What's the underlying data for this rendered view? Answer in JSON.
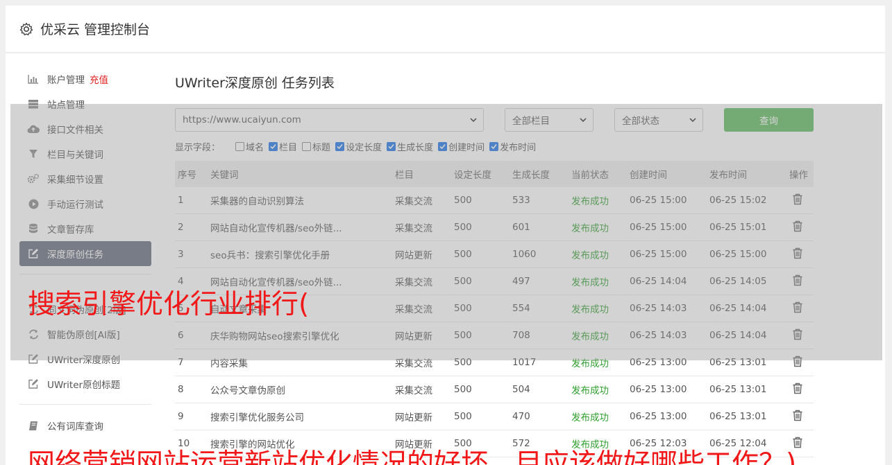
{
  "header": {
    "title": "优采云 管理控制台",
    "icon": "gear-icon"
  },
  "sidebar": {
    "items": [
      {
        "label": "账户管理",
        "badge": "充值",
        "icon": "bar-chart-icon"
      },
      {
        "label": "站点管理",
        "icon": "server-icon"
      },
      {
        "label": "接口文件相关",
        "icon": "cloud-upload-icon"
      },
      {
        "label": "栏目与关键词",
        "icon": "filter-icon"
      },
      {
        "label": "采集细节设置",
        "icon": "gears-icon"
      },
      {
        "label": "手动运行测试",
        "icon": "play-icon"
      },
      {
        "label": "文章暂存库",
        "icon": "database-icon"
      },
      {
        "label": "深度原创任务",
        "icon": "edit-icon",
        "active": true
      },
      {
        "label": "同义词伪原创[2版]",
        "icon": "refresh-icon"
      },
      {
        "label": "智能伪原创[AI版]",
        "icon": "refresh-icon"
      },
      {
        "label": "UWriter深度原创",
        "icon": "edit-icon"
      },
      {
        "label": "UWriter原创标题",
        "icon": "edit-icon"
      },
      {
        "label": "公有词库查询",
        "icon": "book-icon"
      }
    ]
  },
  "main": {
    "title": "UWriter深度原创 任务列表",
    "filters": {
      "site": "https://www.ucaiyun.com",
      "column": "全部栏目",
      "status": "全部状态",
      "query_label": "查询"
    },
    "fields": {
      "label": "显示字段：",
      "options": [
        {
          "label": "域名",
          "checked": false
        },
        {
          "label": "栏目",
          "checked": true
        },
        {
          "label": "标题",
          "checked": false
        },
        {
          "label": "设定长度",
          "checked": true
        },
        {
          "label": "生成长度",
          "checked": true
        },
        {
          "label": "创建时间",
          "checked": true
        },
        {
          "label": "发布时间",
          "checked": true
        }
      ]
    },
    "table": {
      "headers": [
        "序号",
        "关键词",
        "栏目",
        "设定长度",
        "生成长度",
        "当前状态",
        "创建时间",
        "发布时间",
        "操作"
      ],
      "rows": [
        [
          "1",
          "采集器的自动识别算法",
          "采集交流",
          "500",
          "533",
          "发布成功",
          "06-25 15:00",
          "06-25 15:02"
        ],
        [
          "2",
          "网站自动化宣传机器/seo外链...",
          "采集交流",
          "500",
          "601",
          "发布成功",
          "06-25 15:00",
          "06-25 15:01"
        ],
        [
          "3",
          "seo兵书：搜索引擎优化手册",
          "网站更新",
          "500",
          "1060",
          "发布成功",
          "06-25 15:00",
          "06-25 15:00"
        ],
        [
          "4",
          "网站自动化宣传机器/seo外链...",
          "采集交流",
          "500",
          "497",
          "发布成功",
          "06-25 14:04",
          "06-25 14:05"
        ],
        [
          "5",
          "自动文章采集",
          "采集交流",
          "500",
          "554",
          "发布成功",
          "06-25 14:03",
          "06-25 14:04"
        ],
        [
          "6",
          "庆华购物网站seo搜索引擎优化",
          "网站更新",
          "500",
          "708",
          "发布成功",
          "06-25 14:03",
          "06-25 14:04"
        ],
        [
          "7",
          "内容采集",
          "采集交流",
          "500",
          "1017",
          "发布成功",
          "06-25 13:00",
          "06-25 13:01"
        ],
        [
          "8",
          "公众号文章伪原创",
          "采集交流",
          "500",
          "504",
          "发布成功",
          "06-25 13:00",
          "06-25 13:01"
        ],
        [
          "9",
          "搜索引擎优化服务公司",
          "网站更新",
          "500",
          "470",
          "发布成功",
          "06-25 13:00",
          "06-25 13:01"
        ],
        [
          "10",
          "搜索引擎的网站优化",
          "网站更新",
          "500",
          "572",
          "发布成功",
          "06-25 12:03",
          "06-25 12:04"
        ]
      ]
    }
  },
  "overlay_text": {
    "line1": "搜索引擎优化行业排行(",
    "line2": "网络营销网站运营新站优化情况的好坏，目应该做好哪些工作？)"
  },
  "colors": {
    "active_nav": "#626a7a",
    "query_button": "#5cb85c",
    "success": "#2e9e2e",
    "recharge": "#e02020",
    "overlay_text": "#f01818"
  }
}
